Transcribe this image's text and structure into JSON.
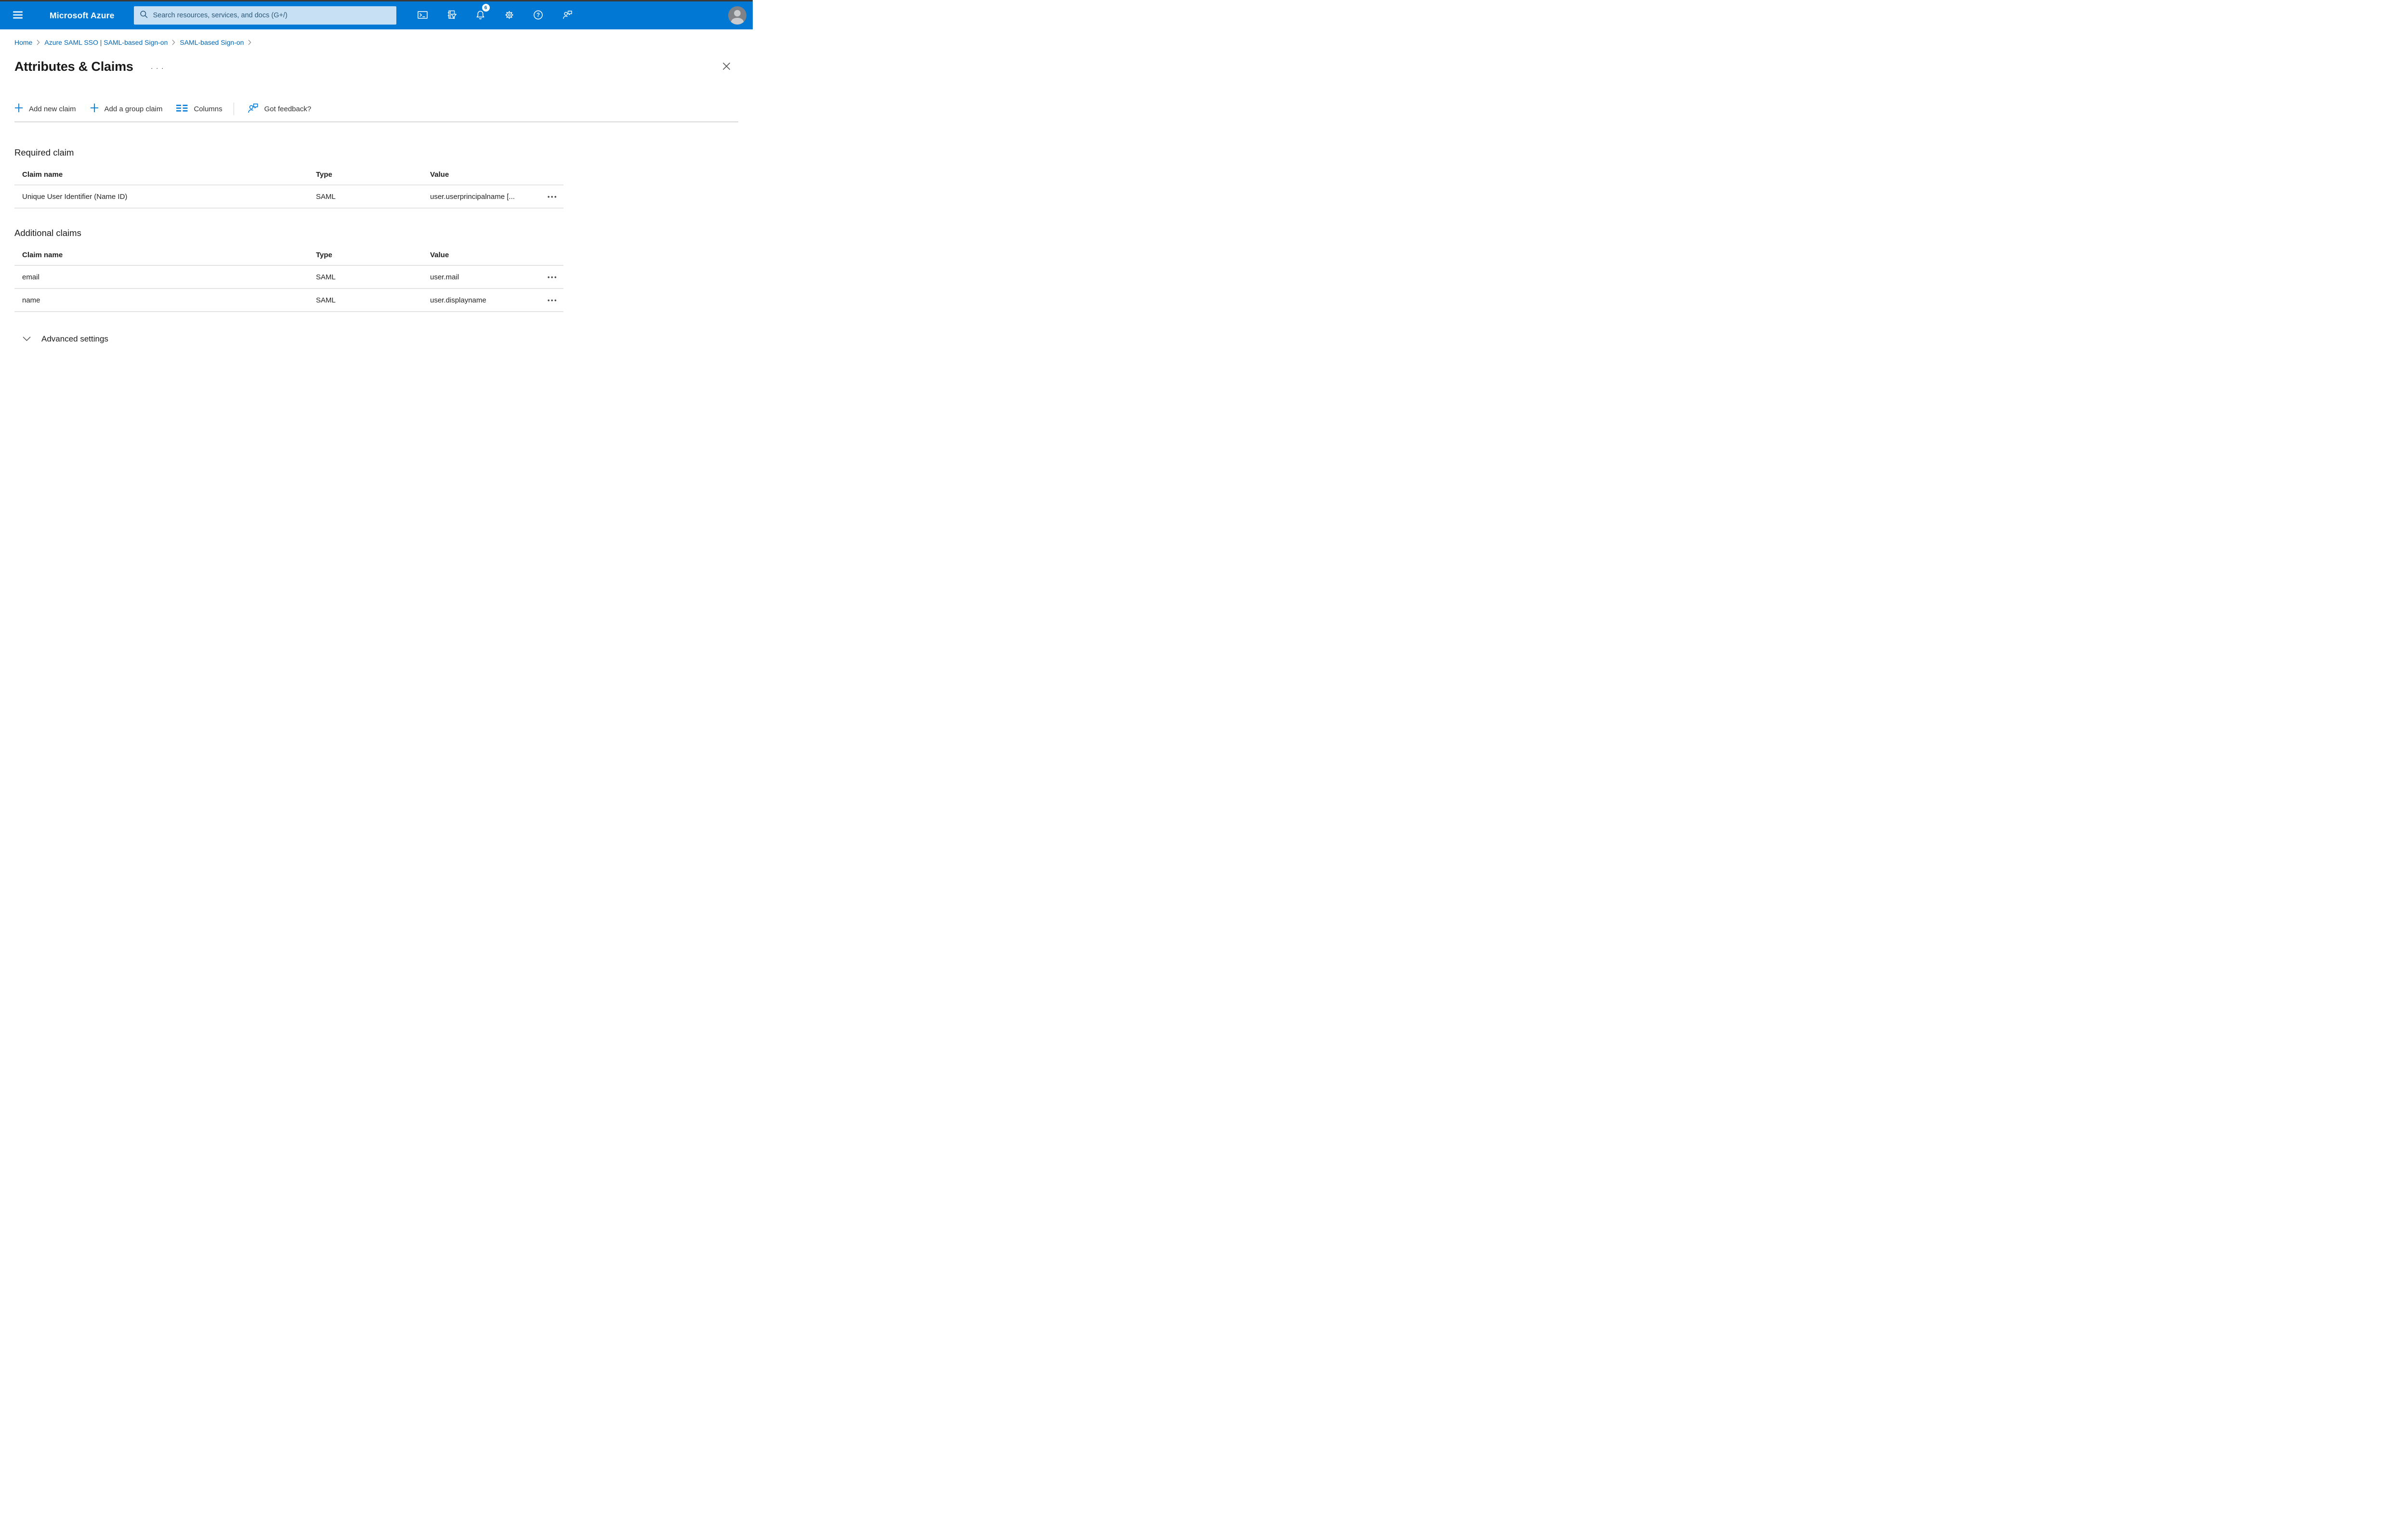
{
  "topbar": {
    "brand": "Microsoft Azure",
    "search_placeholder": "Search resources, services, and docs (G+/)",
    "notification_count": "6"
  },
  "breadcrumb": {
    "items": [
      {
        "label": "Home"
      },
      {
        "label": "Azure SAML SSO | SAML-based Sign-on"
      },
      {
        "label": "SAML-based Sign-on"
      }
    ]
  },
  "page": {
    "title": "Attributes & Claims"
  },
  "icons": {
    "title_more": "···",
    "row_menu": "•••"
  },
  "toolbar": {
    "add_new_claim": "Add new claim",
    "add_group_claim": "Add a group claim",
    "columns": "Columns",
    "got_feedback": "Got feedback?"
  },
  "sections": {
    "required": {
      "heading": "Required claim",
      "columns": {
        "name": "Claim name",
        "type": "Type",
        "value": "Value"
      },
      "rows": [
        {
          "name": "Unique User Identifier (Name ID)",
          "type": "SAML",
          "value": "user.userprincipalname [..."
        }
      ]
    },
    "additional": {
      "heading": "Additional claims",
      "columns": {
        "name": "Claim name",
        "type": "Type",
        "value": "Value"
      },
      "rows": [
        {
          "name": "email",
          "type": "SAML",
          "value": "user.mail"
        },
        {
          "name": "name",
          "type": "SAML",
          "value": "user.displayname"
        }
      ]
    }
  },
  "advanced_settings": {
    "label": "Advanced settings"
  },
  "colors": {
    "topbar_blue": "#0078d4",
    "search_box_blue": "#c7e0f4",
    "link_blue": "#0065b3",
    "text_dark": "#242424",
    "divider_gray": "#e4e4e4",
    "badge_bg": "#ffffff",
    "badge_text": "#0a69b5"
  }
}
